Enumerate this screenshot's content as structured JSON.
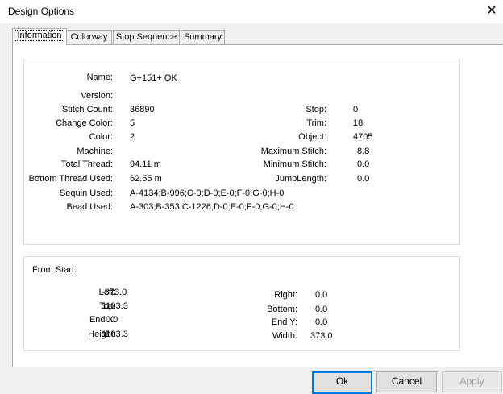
{
  "window": {
    "title": "Design Options",
    "close_glyph": "✕"
  },
  "tabs": [
    {
      "label": "Information",
      "active": true
    },
    {
      "label": "Colorway"
    },
    {
      "label": "Stop Sequence"
    },
    {
      "label": "Summary"
    }
  ],
  "info": {
    "name": {
      "label": "Name:",
      "value": "G+151+ OK"
    },
    "version": {
      "label": "Version:",
      "value": ""
    },
    "stitch_count": {
      "label": "Stitch Count:",
      "value": "36890"
    },
    "change_color": {
      "label": "Change Color:",
      "value": "5"
    },
    "color": {
      "label": "Color:",
      "value": "2"
    },
    "machine": {
      "label": "Machine:",
      "value": ""
    },
    "total_thread": {
      "label": "Total Thread:",
      "value": "94.11 m"
    },
    "bottom_thread": {
      "label": "Bottom Thread Used:",
      "value": "62.55 m"
    },
    "sequin_used": {
      "label": "Sequin Used:",
      "value": "A-4134;B-996;C-0;D-0;E-0;F-0;G-0;H-0"
    },
    "bead_used": {
      "label": "Bead Used:",
      "value": "A-303;B-353;C-1226;D-0;E-0;F-0;G-0;H-0"
    },
    "stop": {
      "label": "Stop:",
      "value": "0"
    },
    "trim": {
      "label": "Trim:",
      "value": "18"
    },
    "object": {
      "label": "Object:",
      "value": "4705"
    },
    "max_stitch": {
      "label": "Maximum Stitch:",
      "value": "8.8"
    },
    "min_stitch": {
      "label": "Minimum Stitch:",
      "value": "0.0"
    },
    "jump_length": {
      "label": "JumpLength:",
      "value": "0.0"
    }
  },
  "from_start": {
    "heading": "From Start:",
    "left": {
      "label": "Left:",
      "value": "-373.0"
    },
    "top": {
      "label": "Top:",
      "value": "1103.3"
    },
    "end_x": {
      "label": "End X:",
      "value": "0.0"
    },
    "height": {
      "label": "Height:",
      "value": "1103.3"
    },
    "right": {
      "label": "Right:",
      "value": "0.0"
    },
    "bottom": {
      "label": "Bottom:",
      "value": "0.0"
    },
    "end_y": {
      "label": "End Y:",
      "value": "0.0"
    },
    "width": {
      "label": "Width:",
      "value": "373.0"
    }
  },
  "buttons": {
    "ok": "Ok",
    "cancel": "Cancel",
    "apply": "Apply"
  },
  "colors": {
    "default_button_border": "#0078d7",
    "dialog_bg": "#f0f0f0"
  }
}
